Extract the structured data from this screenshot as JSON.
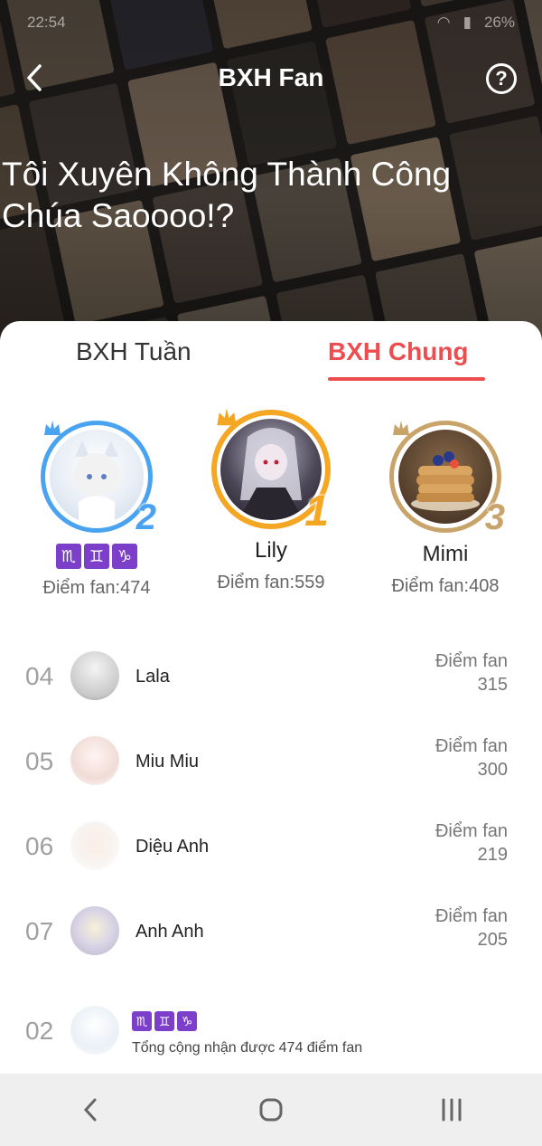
{
  "status": {
    "time": "22:54",
    "battery": "26%"
  },
  "header": {
    "title": "BXH Fan",
    "story_title": "Tôi Xuyên Không Thành Công Chúa Saoooo!?"
  },
  "tabs": {
    "week": "BXH Tuần",
    "all": "BXH Chung"
  },
  "podium": {
    "first": {
      "rank": "1",
      "name": "Lily",
      "score_text": "Điểm fan:559"
    },
    "second": {
      "rank": "2",
      "badges": [
        "♏",
        "♊",
        "♑"
      ],
      "score_text": "Điểm fan:474"
    },
    "third": {
      "rank": "3",
      "name": "Mimi",
      "score_text": "Điểm fan:408"
    }
  },
  "ranking": [
    {
      "rank": "04",
      "name": "Lala",
      "score_label": "Điểm fan",
      "score": "315"
    },
    {
      "rank": "05",
      "name": "Miu Miu",
      "score_label": "Điểm fan",
      "score": "300"
    },
    {
      "rank": "06",
      "name": "Diệu Anh",
      "score_label": "Điểm fan",
      "score": "219"
    },
    {
      "rank": "07",
      "name": "Anh Anh",
      "score_label": "Điểm fan",
      "score": "205"
    }
  ],
  "me": {
    "rank": "02",
    "badges": [
      "♏",
      "♊",
      "♑"
    ],
    "summary": "Tổng cộng nhận được 474 điểm fan"
  },
  "colors": {
    "accent": "#ee4d4f",
    "badge": "#7b3fc9",
    "gold": "#f5a623",
    "blue": "#4aa3f0",
    "bronze": "#c9a46a"
  }
}
